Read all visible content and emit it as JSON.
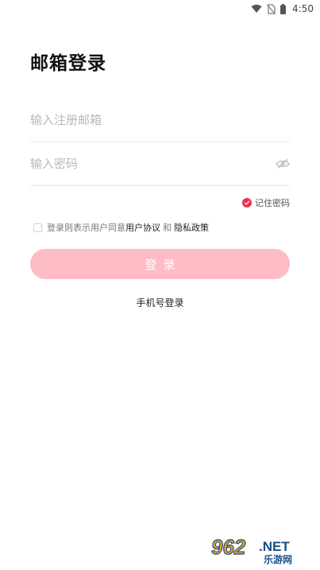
{
  "status_bar": {
    "time": "4:50"
  },
  "page": {
    "title": "邮箱登录"
  },
  "form": {
    "email_placeholder": "输入注册邮箱",
    "email_value": "",
    "password_placeholder": "输入密码",
    "password_value": ""
  },
  "remember": {
    "label": "记住密码",
    "checked": true
  },
  "agreement": {
    "prefix": "登录则表示用户同意",
    "user_agreement": "用户协议",
    "connector": "和",
    "privacy_policy": "隐私政策",
    "checked": false
  },
  "login_button": {
    "label": "登录"
  },
  "alt_login": {
    "label": "手机号登录"
  },
  "watermark": {
    "brand_number": "962",
    "brand_suffix": ".NET",
    "brand_cn": "乐游网"
  },
  "colors": {
    "accent": "#e8344e",
    "button_bg": "#fdbcc6",
    "placeholder": "#b8b8b8"
  },
  "icons": [
    "wifi-icon",
    "no-sim-icon",
    "battery-icon",
    "eye-closed-icon",
    "check-icon"
  ]
}
